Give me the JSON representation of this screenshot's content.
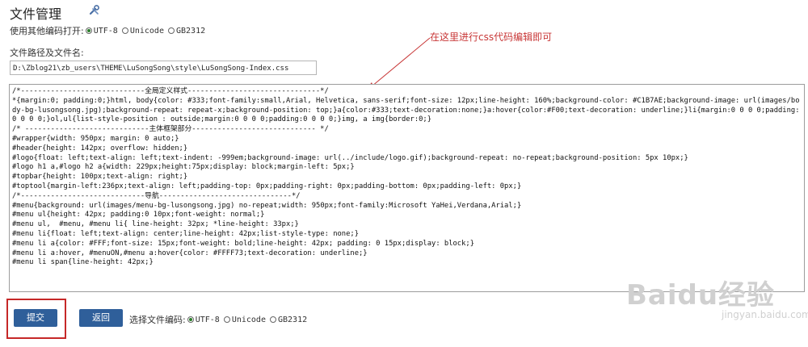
{
  "header": {
    "title": "文件管理",
    "tool_icon": "wrench-icon"
  },
  "encoding_open": {
    "label": "使用其他编码打开:",
    "options": [
      "UTF-8",
      "Unicode",
      "GB2312"
    ],
    "selected": "UTF-8"
  },
  "file_path": {
    "label": "文件路径及文件名:",
    "value": "D:\\Zblog21\\zb_users\\THEME\\LuSongSong\\style\\LuSongSong-Index.css"
  },
  "annotation": {
    "text": "在这里进行css代码编辑即可",
    "color": "#c83737"
  },
  "editor": {
    "content": "/*-----------------------------全局定义样式-------------------------------*/\n*{margin:0; padding:0;}html, body{color: #333;font-family:small,Arial, Helvetica, sans-serif;font-size: 12px;line-height: 160%;background-color: #C1B7AE;background-image: url(images/body-bg-lusongsong.jpg);background-repeat: repeat-x;background-position: top;}a{color:#333;text-decoration:none;}a:hover{color:#F00;text-decoration: underline;}li{margin:0 0 0 0;padding:0 0 0 0;}ol,ul{list-style-position : outside;margin:0 0 0 0;padding:0 0 0 0;}img, a img{border:0;}\n/* -----------------------------主体框架部分----------------------------- */\n#wrapper{width: 950px; margin: 0 auto;}\n#header{height: 142px; overflow: hidden;}\n#logo{float: left;text-align: left;text-indent: -999em;background-image: url(../include/logo.gif);background-repeat: no-repeat;background-position: 5px 10px;}\n#logo h1 a,#logo h2 a{width: 229px;height:75px;display: block;margin-left: 5px;}\n#topbar{height: 100px;text-align: right;}\n#toptool{margin-left:236px;text-align: left;padding-top: 0px;padding-right: 0px;padding-bottom: 0px;padding-left: 0px;}\n/*-----------------------------导航-------------------------------*/\n#menu{background: url(images/menu-bg-lusongsong.jpg) no-repeat;width: 950px;font-family:Microsoft YaHei,Verdana,Arial;}\n#menu ul{height: 42px; padding:0 10px;font-weight: normal;}\n#menu ul,  #menu, #menu li{ line-height: 32px; *line-height: 33px;}\n#menu li{float: left;text-align: center;line-height: 42px;list-style-type: none;}\n#menu li a{color: #FFF;font-size: 15px;font-weight: bold;line-height: 42px; padding: 0 15px;display: block;}\n#menu li a:hover, #menuON,#menu a:hover{color: #FFFF73;text-decoration: underline;}\n#menu li span{line-height: 42px;}"
  },
  "actions": {
    "submit_label": "提交",
    "back_label": "返回"
  },
  "encoding_save": {
    "label": "选择文件编码:",
    "options": [
      "UTF-8",
      "Unicode",
      "GB2312"
    ],
    "selected": "UTF-8"
  },
  "watermark": {
    "big": "Baidu经验",
    "small": "jingyan.baidu.com"
  },
  "colors": {
    "button": "#2f5f9a",
    "highlight": "#c62828",
    "arrow": "#c83737"
  }
}
